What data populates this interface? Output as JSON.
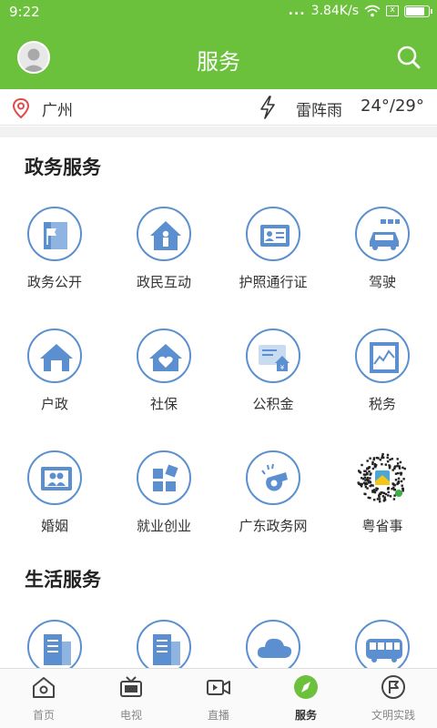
{
  "status": {
    "time": "9:22",
    "speed": "3.84K/s",
    "dots": "...",
    "x_badge": "x",
    "battery_level": 0.9
  },
  "header": {
    "title": "服务"
  },
  "weather": {
    "city": "广州",
    "condition": "雷阵雨",
    "temp": "24°/29°"
  },
  "sections": [
    {
      "title": "政务服务",
      "items": [
        {
          "label": "政务公开",
          "icon": "flag-document-icon"
        },
        {
          "label": "政民互动",
          "icon": "house-person-icon"
        },
        {
          "label": "护照通行证",
          "icon": "id-card-icon"
        },
        {
          "label": "驾驶",
          "icon": "car-icon"
        },
        {
          "label": "户政",
          "icon": "house-icon"
        },
        {
          "label": "社保",
          "icon": "house-heart-icon"
        },
        {
          "label": "公积金",
          "icon": "fund-card-icon"
        },
        {
          "label": "税务",
          "icon": "tax-chart-icon"
        },
        {
          "label": "婚姻",
          "icon": "marriage-photo-icon"
        },
        {
          "label": "就业创业",
          "icon": "blocks-icon"
        },
        {
          "label": "广东政务网",
          "icon": "whistle-icon"
        },
        {
          "label": "粤省事",
          "icon": "qr-code-icon"
        }
      ]
    },
    {
      "title": "生活服务",
      "items": [
        {
          "label": "",
          "icon": "building-icon"
        },
        {
          "label": "",
          "icon": "building-icon"
        },
        {
          "label": "",
          "icon": "cloud-icon"
        },
        {
          "label": "",
          "icon": "bus-icon"
        }
      ]
    }
  ],
  "tabs": [
    {
      "label": "首页",
      "icon": "home-icon",
      "active": false
    },
    {
      "label": "电视",
      "icon": "tv-icon",
      "active": false
    },
    {
      "label": "直播",
      "icon": "live-camera-icon",
      "active": false
    },
    {
      "label": "服务",
      "icon": "compass-icon",
      "active": true
    },
    {
      "label": "文明实践",
      "icon": "flag-circle-icon",
      "active": false
    }
  ],
  "colors": {
    "brand_green": "#6cc13c",
    "icon_blue": "#5b8fcf"
  }
}
